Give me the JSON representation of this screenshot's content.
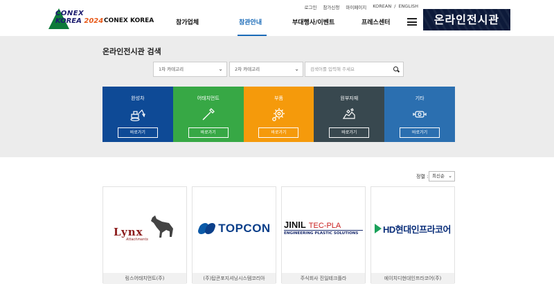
{
  "header": {
    "logo": {
      "line1": "CONEX",
      "line2": "KOREA",
      "year": "2024"
    },
    "utility_links": [
      "로그인",
      "참가신청",
      "마이페이지",
      "KOREAN",
      "/",
      "ENGLISH"
    ],
    "nav": [
      {
        "label": "CONEX KOREA",
        "active": false
      },
      {
        "label": "참가업체",
        "active": false
      },
      {
        "label": "참관안내",
        "active": true
      },
      {
        "label": "부대행사/이벤트",
        "active": false
      },
      {
        "label": "프레스센터",
        "active": false
      }
    ],
    "banner_text": "온라인전시관",
    "accent_color": "#1a6bb8"
  },
  "search": {
    "title": "온라인전시관 검색",
    "category1": "1차 카테고리",
    "category2": "2차 카테고리",
    "keyword_placeholder": "검색어를 입력해 주세요"
  },
  "categories": [
    {
      "name": "완성차",
      "button": "바로가기",
      "color": "#0e4a96",
      "icon": "excavator-icon"
    },
    {
      "name": "어태치먼트",
      "button": "바로가기",
      "color": "#37a845",
      "icon": "attachment-icon"
    },
    {
      "name": "부품",
      "button": "바로가기",
      "color": "#f59a0b",
      "icon": "gear-icon"
    },
    {
      "name": "원부자재",
      "button": "바로가기",
      "color": "#38484f",
      "icon": "materials-icon"
    },
    {
      "name": "기타",
      "button": "바로가기",
      "color": "#2b6fb0",
      "icon": "parts-icon"
    }
  ],
  "sort": {
    "label": "정렬 :",
    "selected": "최신순"
  },
  "exhibitors": [
    {
      "logo_text": "Lynx",
      "logo_sub": "Attachments",
      "name": "링스어태치먼트(주)"
    },
    {
      "logo_text": "TOPCON",
      "name": "(주)탑콘포지셔닝시스템코리아"
    },
    {
      "logo_text": "JINIL",
      "logo_tag": "TEC-PLA",
      "logo_sub": "ENGINEERING PLASTIC SOLUTIONS",
      "name": "주식회사 진일테크플라"
    },
    {
      "logo_text": "HD현대인프라코어",
      "name": "에이치디현대인프라코어(주)"
    }
  ]
}
